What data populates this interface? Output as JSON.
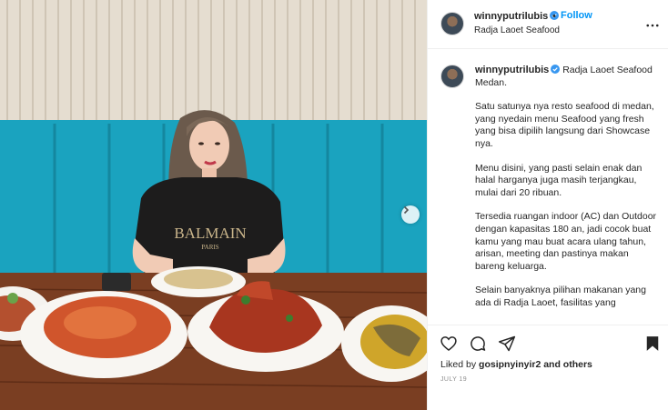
{
  "post": {
    "username": "winnyputrilubis",
    "follow_label": "Follow",
    "separator": "•",
    "location": "Radja Laoet Seafood",
    "caption_title": "Radja Laoet Seafood Medan.",
    "caption_paragraphs": [
      "Satu satunya nya resto seafood di medan, yang nyedain menu Seafood yang fresh yang bisa dipilih langsung dari Showcase nya.",
      "Menu disini, yang pasti selain enak dan halal harganya juga masih terjangkau, mulai dari 20 ribuan.",
      "Tersedia ruangan indoor (AC) dan Outdoor dengan kapasitas 180 an, jadi cocok buat kamu yang mau buat acara ulang tahun, arisan, meeting dan pastinya makan bareng keluarga.",
      "Selain banyaknya pilihan makanan yang ada di Radja Laoet, fasilitas yang"
    ],
    "liked_prefix": "Liked by ",
    "liked_user": "gosipnyinyir2",
    "liked_suffix": " and others",
    "date": "JULY 19"
  },
  "photo": {
    "shirt_text_1": "BALMAIN",
    "shirt_text_2": "PARIS"
  },
  "icons": {
    "verified": "verified-badge-icon",
    "more": "more-options-icon",
    "like": "heart-icon",
    "comment": "comment-icon",
    "share": "send-icon",
    "save": "bookmark-icon",
    "next": "chevron-right-icon"
  },
  "colors": {
    "accent": "#0095f6",
    "text": "#262626",
    "muted": "#8e8e8e",
    "sofa": "#1aa3bf"
  }
}
